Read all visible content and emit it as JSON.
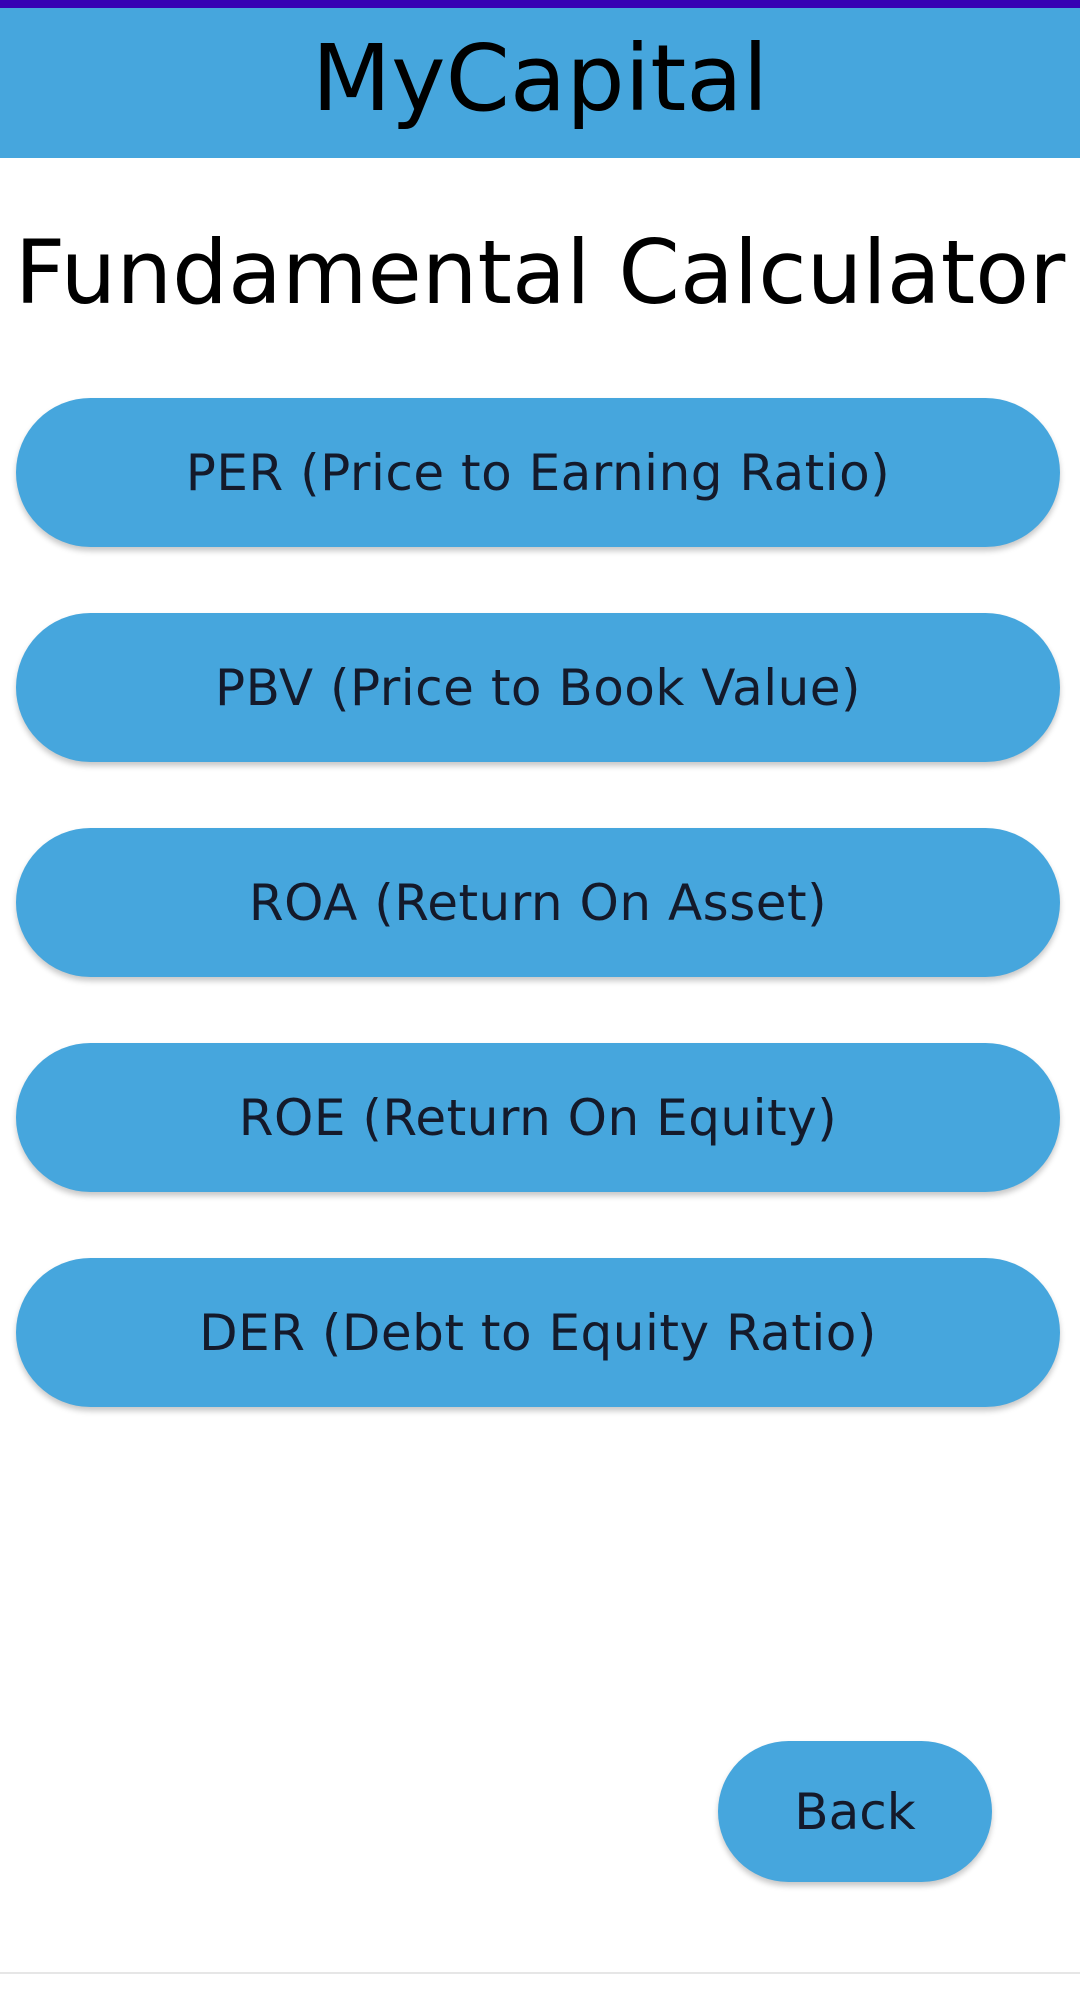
{
  "app_bar": {
    "title": "MyCapital"
  },
  "page": {
    "heading": "Fundamental Calculator"
  },
  "calculators": [
    {
      "label": "PER (Price to Earning Ratio)"
    },
    {
      "label": "PBV (Price to Book Value)"
    },
    {
      "label": "ROA (Return On Asset)"
    },
    {
      "label": "ROE (Return On Equity)"
    },
    {
      "label": "DER (Debt to Equity Ratio)"
    }
  ],
  "footer": {
    "back_label": "Back"
  },
  "colors": {
    "status_bar": "#3700b3",
    "primary": "#46a6dd",
    "button_text": "#141a2b",
    "background": "#ffffff"
  }
}
